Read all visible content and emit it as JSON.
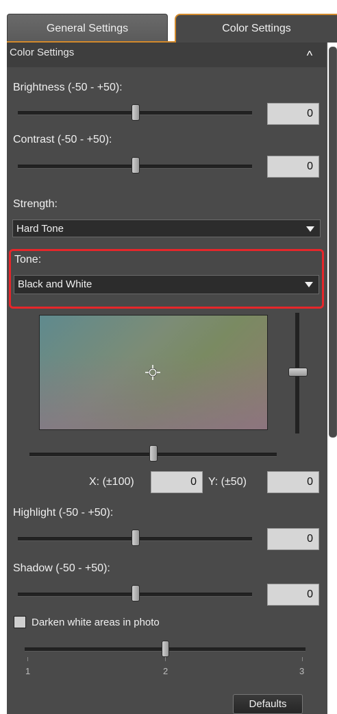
{
  "tabs": [
    {
      "label": "General Settings",
      "active": false
    },
    {
      "label": "Color Settings",
      "active": true
    }
  ],
  "section": {
    "title": "Color Settings",
    "collapse_glyph": "^"
  },
  "brightness": {
    "label": "Brightness (-50 - +50):",
    "value": "0",
    "slider_fraction": 0.5
  },
  "contrast": {
    "label": "Contrast (-50 - +50):",
    "value": "0",
    "slider_fraction": 0.5
  },
  "strength": {
    "label": "Strength:",
    "selected": "Hard Tone"
  },
  "tone": {
    "label": "Tone:",
    "selected": "Black and White"
  },
  "tone_adjust": {
    "x_label": "X: (±100)",
    "x_value": "0",
    "y_label": "Y: (±50)",
    "y_value": "0"
  },
  "highlight": {
    "label": "Highlight (-50 - +50):",
    "value": "0",
    "slider_fraction": 0.5
  },
  "shadow": {
    "label": "Shadow (-50 - +50):",
    "value": "0",
    "slider_fraction": 0.5
  },
  "darken": {
    "label": "Darken white areas in photo",
    "checked": false
  },
  "level_slider": {
    "ticks": [
      "1",
      "2",
      "3"
    ],
    "value": 2
  },
  "defaults_button": "Defaults",
  "colors": {
    "accent_tab": "#d38a2c",
    "highlight_border": "#e6262a",
    "panel": "#4a4a4a"
  }
}
